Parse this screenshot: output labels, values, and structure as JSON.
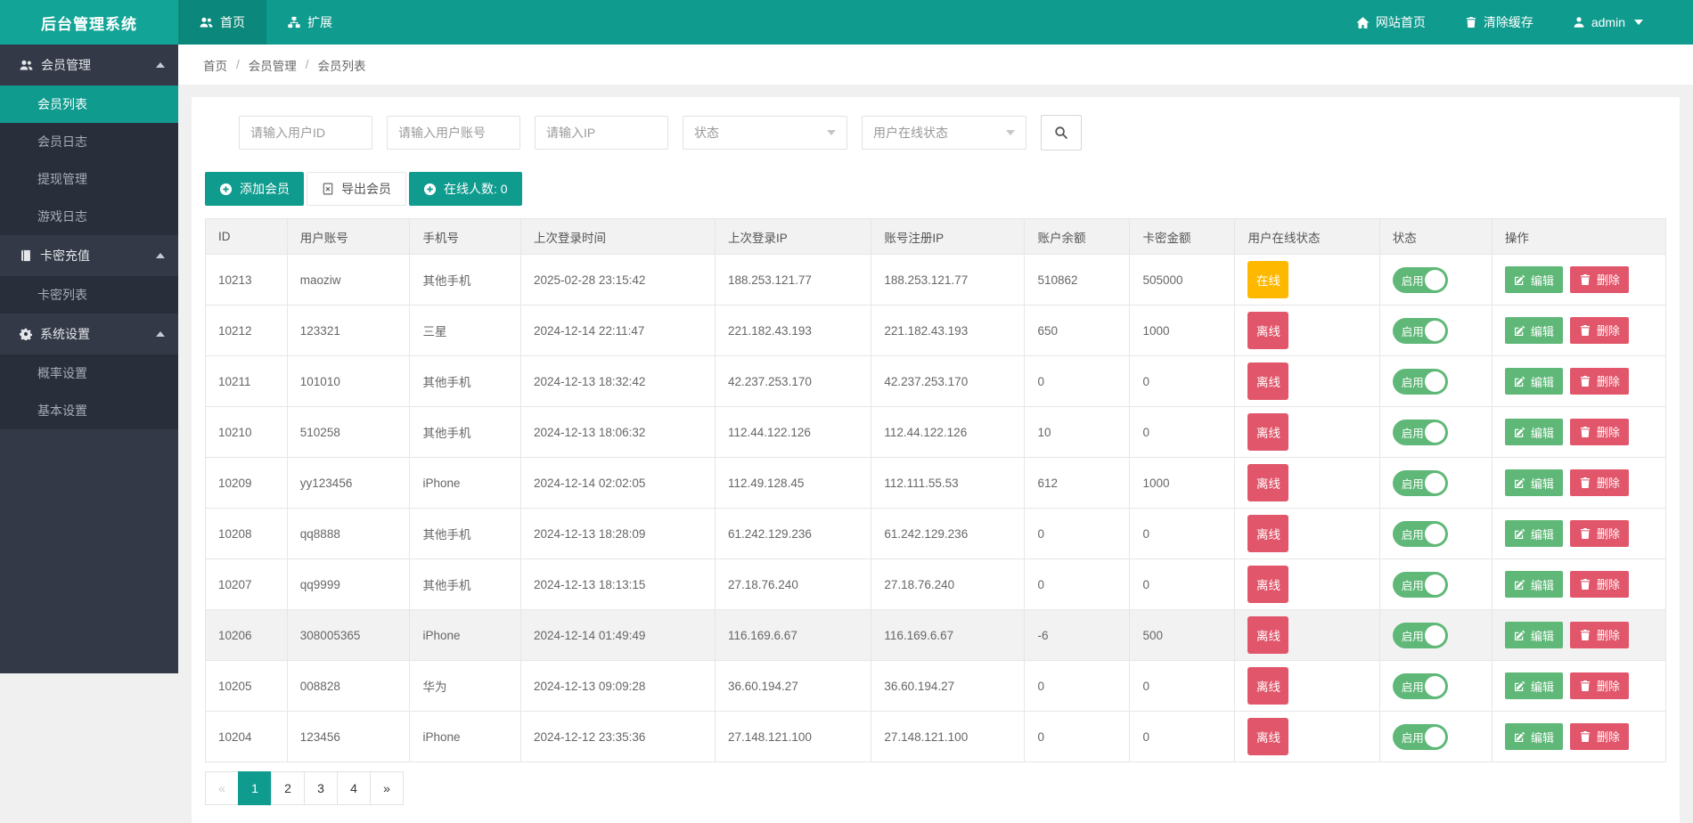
{
  "topbar": {
    "logo": "后台管理系统",
    "tabs": [
      {
        "name": "home",
        "label": "首页",
        "icon": "users-icon",
        "active": true
      },
      {
        "name": "extension",
        "label": "扩展",
        "icon": "sitemap-icon",
        "active": false
      }
    ],
    "right": [
      {
        "name": "site-home",
        "label": "网站首页",
        "icon": "home-icon",
        "caret": false
      },
      {
        "name": "clear-cache",
        "label": "清除缓存",
        "icon": "trash-icon",
        "caret": false
      },
      {
        "name": "admin-menu",
        "label": "admin",
        "icon": "user-icon",
        "caret": true
      }
    ]
  },
  "sidebar": {
    "sections": [
      {
        "name": "member-management",
        "label": "会员管理",
        "icon": "users-icon",
        "expanded": true,
        "items": [
          {
            "name": "member-list",
            "label": "会员列表",
            "active": true
          },
          {
            "name": "member-logs",
            "label": "会员日志",
            "active": false
          },
          {
            "name": "withdraw-management",
            "label": "提现管理",
            "active": false
          },
          {
            "name": "game-logs",
            "label": "游戏日志",
            "active": false
          }
        ]
      },
      {
        "name": "card-recharge",
        "label": "卡密充值",
        "icon": "book-icon",
        "expanded": true,
        "items": [
          {
            "name": "card-list",
            "label": "卡密列表",
            "active": false
          }
        ]
      },
      {
        "name": "system-settings",
        "label": "系统设置",
        "icon": "gear-icon",
        "expanded": true,
        "items": [
          {
            "name": "probability-settings",
            "label": "概率设置",
            "active": false
          },
          {
            "name": "basic-settings",
            "label": "基本设置",
            "active": false
          }
        ]
      }
    ]
  },
  "breadcrumb": {
    "items": [
      "首页",
      "会员管理",
      "会员列表"
    ],
    "separator": "/"
  },
  "filters": {
    "inputs": [
      {
        "name": "user-id-input",
        "placeholder": "请输入用户ID"
      },
      {
        "name": "account-input",
        "placeholder": "请输入用户账号"
      },
      {
        "name": "ip-input",
        "placeholder": "请输入IP"
      }
    ],
    "selects": [
      {
        "name": "status-select",
        "value": "状态"
      },
      {
        "name": "online-status-select",
        "value": "用户在线状态"
      }
    ]
  },
  "actions": [
    {
      "name": "add-member-button",
      "label": "添加会员",
      "icon": "plus-circle-icon",
      "style": "teal"
    },
    {
      "name": "export-member-button",
      "label": "导出会员",
      "icon": "excel-icon",
      "style": "white"
    },
    {
      "name": "online-count-button",
      "label": "在线人数: 0",
      "icon": "plus-circle-icon",
      "style": "teal"
    }
  ],
  "table": {
    "columns": [
      "ID",
      "用户账号",
      "手机号",
      "上次登录时间",
      "上次登录IP",
      "账号注册IP",
      "账户余额",
      "卡密金额",
      "用户在线状态",
      "状态",
      "操作"
    ],
    "online_label": "在线",
    "offline_label": "离线",
    "enabled_label": "启用",
    "edit_label": "编辑",
    "delete_label": "删除",
    "rows": [
      {
        "id": "10213",
        "account": "maoziw",
        "phone": "其他手机",
        "last_login_time": "2025-02-28 23:15:42",
        "last_login_ip": "188.253.121.77",
        "register_ip": "188.253.121.77",
        "balance": "510862",
        "card_amount": "505000",
        "online": true,
        "highlight": false
      },
      {
        "id": "10212",
        "account": "123321",
        "phone": "三星",
        "last_login_time": "2024-12-14 22:11:47",
        "last_login_ip": "221.182.43.193",
        "register_ip": "221.182.43.193",
        "balance": "650",
        "card_amount": "1000",
        "online": false,
        "highlight": false
      },
      {
        "id": "10211",
        "account": "101010",
        "phone": "其他手机",
        "last_login_time": "2024-12-13 18:32:42",
        "last_login_ip": "42.237.253.170",
        "register_ip": "42.237.253.170",
        "balance": "0",
        "card_amount": "0",
        "online": false,
        "highlight": false
      },
      {
        "id": "10210",
        "account": "510258",
        "phone": "其他手机",
        "last_login_time": "2024-12-13 18:06:32",
        "last_login_ip": "112.44.122.126",
        "register_ip": "112.44.122.126",
        "balance": "10",
        "card_amount": "0",
        "online": false,
        "highlight": false
      },
      {
        "id": "10209",
        "account": "yy123456",
        "phone": "iPhone",
        "last_login_time": "2024-12-14 02:02:05",
        "last_login_ip": "112.49.128.45",
        "register_ip": "112.111.55.53",
        "balance": "612",
        "card_amount": "1000",
        "online": false,
        "highlight": false
      },
      {
        "id": "10208",
        "account": "qq8888",
        "phone": "其他手机",
        "last_login_time": "2024-12-13 18:28:09",
        "last_login_ip": "61.242.129.236",
        "register_ip": "61.242.129.236",
        "balance": "0",
        "card_amount": "0",
        "online": false,
        "highlight": false
      },
      {
        "id": "10207",
        "account": "qq9999",
        "phone": "其他手机",
        "last_login_time": "2024-12-13 18:13:15",
        "last_login_ip": "27.18.76.240",
        "register_ip": "27.18.76.240",
        "balance": "0",
        "card_amount": "0",
        "online": false,
        "highlight": false
      },
      {
        "id": "10206",
        "account": "308005365",
        "phone": "iPhone",
        "last_login_time": "2024-12-14 01:49:49",
        "last_login_ip": "116.169.6.67",
        "register_ip": "116.169.6.67",
        "balance": "-6",
        "card_amount": "500",
        "online": false,
        "highlight": true
      },
      {
        "id": "10205",
        "account": "008828",
        "phone": "华为",
        "last_login_time": "2024-12-13 09:09:28",
        "last_login_ip": "36.60.194.27",
        "register_ip": "36.60.194.27",
        "balance": "0",
        "card_amount": "0",
        "online": false,
        "highlight": false
      },
      {
        "id": "10204",
        "account": "123456",
        "phone": "iPhone",
        "last_login_time": "2024-12-12 23:35:36",
        "last_login_ip": "27.148.121.100",
        "register_ip": "27.148.121.100",
        "balance": "0",
        "card_amount": "0",
        "online": false,
        "highlight": false
      }
    ]
  },
  "pagination": {
    "items": [
      {
        "name": "page-prev",
        "label": "«",
        "state": "disabled"
      },
      {
        "name": "page-1",
        "label": "1",
        "state": "active"
      },
      {
        "name": "page-2",
        "label": "2",
        "state": "normal"
      },
      {
        "name": "page-3",
        "label": "3",
        "state": "normal"
      },
      {
        "name": "page-4",
        "label": "4",
        "state": "normal"
      },
      {
        "name": "page-next",
        "label": "»",
        "state": "normal"
      }
    ]
  },
  "colors": {
    "topbar_teal": "#0f9b8e",
    "logo_teal": "#12a496",
    "active_tab_teal": "#0b887b",
    "sidebar_bg": "#333947",
    "sidebar_submenu_bg": "#282e3a",
    "accent_teal": "#0f9b8e",
    "online_badge": "#ffb800",
    "offline_badge": "#e1566a",
    "enabled_green": "#5fb878",
    "edit_green": "#5fb878",
    "delete_red": "#e1566a",
    "page_bg": "#f0f0f0"
  }
}
